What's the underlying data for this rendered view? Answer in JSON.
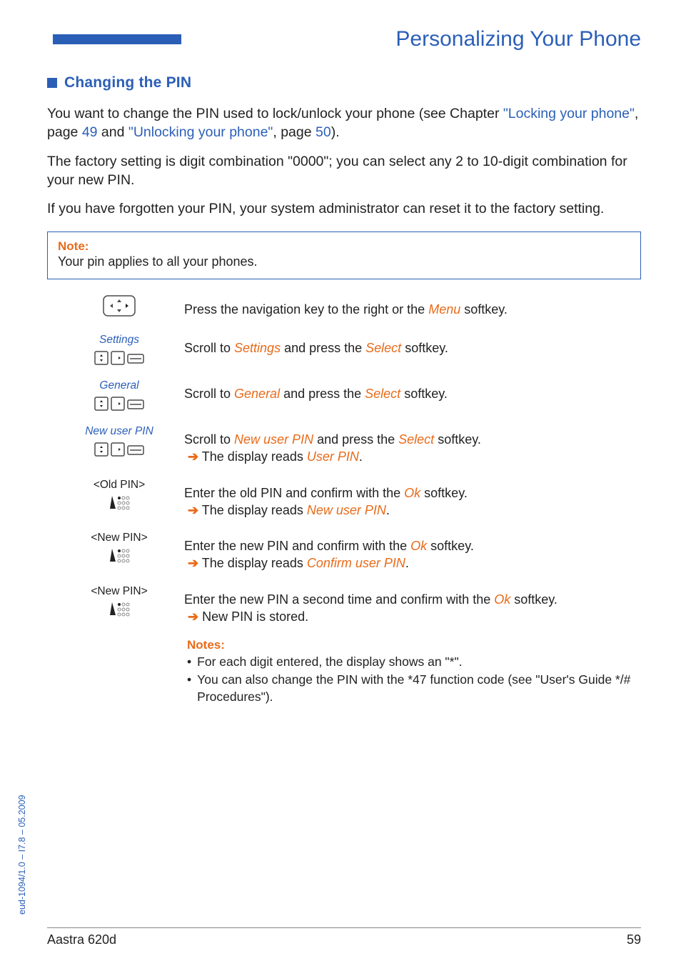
{
  "header": {
    "title": "Personalizing Your Phone"
  },
  "section": {
    "heading": "Changing the PIN"
  },
  "intro": {
    "p1_a": "You want to change the PIN used to lock/unlock your phone (see Chapter ",
    "p1_link1": "\"Locking your phone\"",
    "p1_b": ", page ",
    "p1_page1": "49",
    "p1_c": " and ",
    "p1_link2": "\"Unlocking your phone\"",
    "p1_d": ", page ",
    "p1_page2": "50",
    "p1_e": ").",
    "p2": "The factory setting is digit combination \"0000\"; you can select any 2 to 10-digit combination for your new PIN.",
    "p3": "If you have forgotten your PIN, your system administrator can reset it to the factory setting."
  },
  "note": {
    "label": "Note:",
    "text": "Your pin applies to all your phones."
  },
  "steps": {
    "s1": {
      "desc_a": "Press the navigation key to the right or the ",
      "em1": "Menu",
      "desc_b": " softkey."
    },
    "s2": {
      "label": "Settings",
      "desc_a": "Scroll to ",
      "em1": "Settings",
      "desc_b": " and press the ",
      "em2": "Select",
      "desc_c": " softkey."
    },
    "s3": {
      "label": "General",
      "desc_a": "Scroll to ",
      "em1": "General",
      "desc_b": " and press the ",
      "em2": "Select",
      "desc_c": " softkey."
    },
    "s4": {
      "label": "New user PIN",
      "desc_a": "Scroll to ",
      "em1": "New user PIN",
      "desc_b": " and press the ",
      "em2": "Select",
      "desc_c": " softkey.",
      "arrow": "➔",
      "sub_a": " The display reads ",
      "em3": "User PIN",
      "sub_b": "."
    },
    "s5": {
      "label": "<Old PIN>",
      "desc_a": "Enter the old PIN and confirm with the ",
      "em1": "Ok",
      "desc_b": " softkey.",
      "arrow": "➔",
      "sub_a": " The display reads ",
      "em2": "New user PIN",
      "sub_b": "."
    },
    "s6": {
      "label": "<New PIN>",
      "desc_a": "Enter the new PIN and confirm with the ",
      "em1": "Ok",
      "desc_b": " softkey.",
      "arrow": "➔",
      "sub_a": " The display reads ",
      "em2": "Confirm user PIN",
      "sub_b": "."
    },
    "s7": {
      "label": "<New PIN>",
      "desc_a": "Enter the new PIN a second time and confirm with the ",
      "em1": "Ok",
      "desc_b": " softkey.",
      "arrow": "➔",
      "sub_a": " New PIN is stored."
    }
  },
  "notes_block": {
    "label": "Notes:",
    "i1": "For each digit entered, the display shows an \"*\".",
    "i2": "You can also change the PIN with the *47 function code (see \"User's Guide */# Procedures\")."
  },
  "footer": {
    "left": "Aastra 620d",
    "right": "59"
  },
  "side": {
    "text": "eud-1094/1.0 – I7.8 – 05.2009"
  }
}
